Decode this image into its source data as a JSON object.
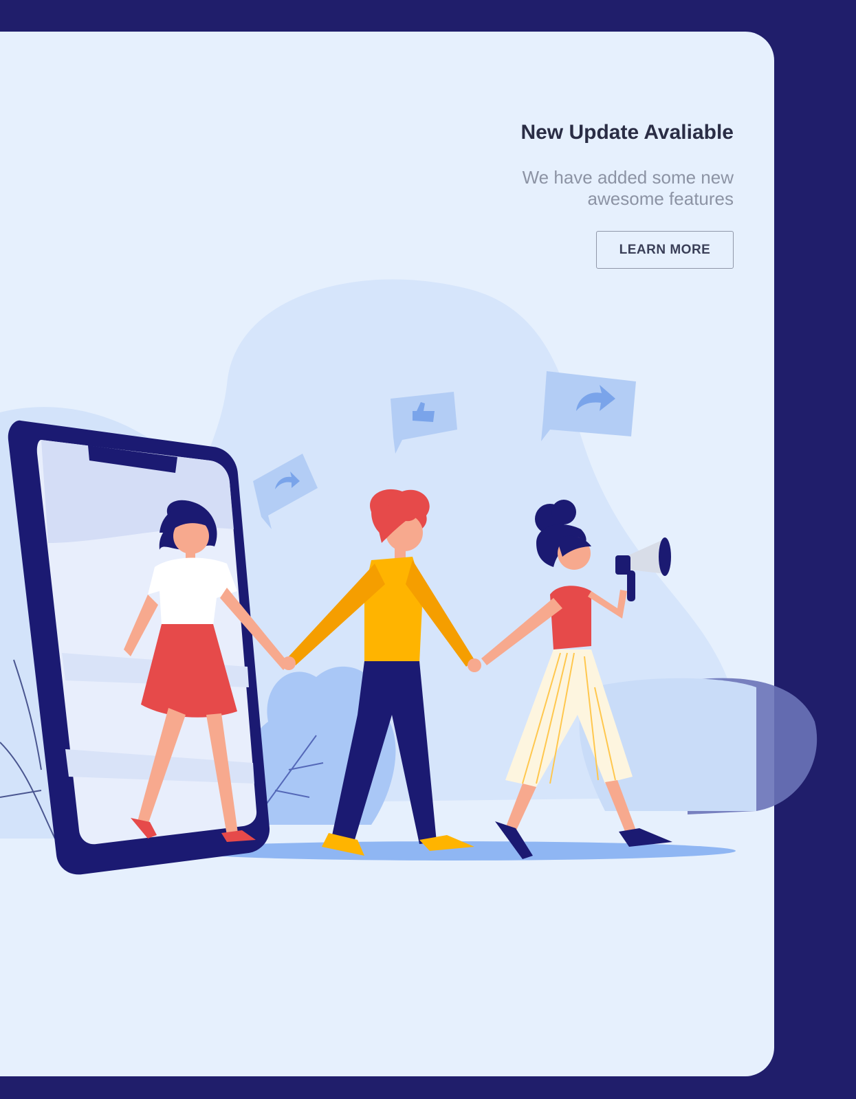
{
  "update": {
    "title": "New Update Avaliable",
    "description": "We have added some new awesome features",
    "button_label": "LEARN MORE"
  },
  "colors": {
    "background": "#201e6b",
    "card": "#e6f0fd",
    "title": "#2a2d45",
    "description": "#8c93a4",
    "accent_red": "#e64a4a",
    "accent_yellow": "#ffb400",
    "navy": "#1c1a78"
  },
  "icons": [
    "share-icon",
    "thumbs-up-icon",
    "megaphone-icon"
  ]
}
